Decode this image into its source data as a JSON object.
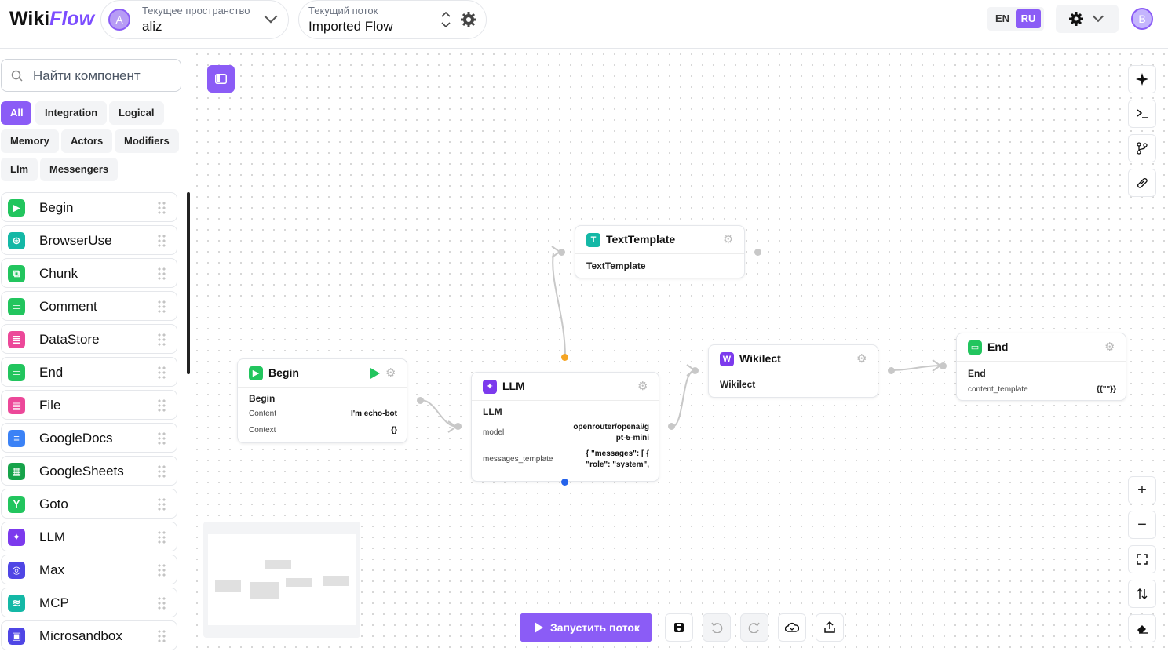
{
  "header": {
    "logo_wiki": "Wiki",
    "logo_flow": "Flow",
    "workspace": {
      "label": "Текущее пространство",
      "value": "aliz",
      "avatar": "A"
    },
    "flow": {
      "label": "Текущий поток",
      "value": "Imported Flow"
    },
    "lang_en": "EN",
    "lang_ru": "RU",
    "user_avatar": "B"
  },
  "sidebar": {
    "search_placeholder": "Найти компонент",
    "filters": [
      "All",
      "Integration",
      "Logical",
      "Memory",
      "Actors",
      "Modifiers",
      "Llm",
      "Messengers"
    ],
    "components": [
      {
        "label": "Begin",
        "icon": "play-icon",
        "color": "#22c55e",
        "glyph": "▶"
      },
      {
        "label": "BrowserUse",
        "icon": "globe-icon",
        "color": "#14b8a6",
        "glyph": "⊕"
      },
      {
        "label": "Chunk",
        "icon": "chunk-icon",
        "color": "#22c55e",
        "glyph": "⧉"
      },
      {
        "label": "Comment",
        "icon": "comment-icon",
        "color": "#22c55e",
        "glyph": "▭"
      },
      {
        "label": "DataStore",
        "icon": "database-icon",
        "color": "#ec4899",
        "glyph": "≣"
      },
      {
        "label": "End",
        "icon": "end-icon",
        "color": "#22c55e",
        "glyph": "▭"
      },
      {
        "label": "File",
        "icon": "file-icon",
        "color": "#ec4899",
        "glyph": "▤"
      },
      {
        "label": "GoogleDocs",
        "icon": "google-docs-icon",
        "color": "#3b82f6",
        "glyph": "≡"
      },
      {
        "label": "GoogleSheets",
        "icon": "google-sheets-icon",
        "color": "#16a34a",
        "glyph": "▦"
      },
      {
        "label": "Goto",
        "icon": "branch-icon",
        "color": "#22c55e",
        "glyph": "Y"
      },
      {
        "label": "LLM",
        "icon": "sparkle-icon",
        "color": "#7c3aed",
        "glyph": "✦"
      },
      {
        "label": "Max",
        "icon": "max-icon",
        "color": "#4f46e5",
        "glyph": "◎"
      },
      {
        "label": "MCP",
        "icon": "mcp-icon",
        "color": "#14b8a6",
        "glyph": "≋"
      },
      {
        "label": "Microsandbox",
        "icon": "sandbox-icon",
        "color": "#4f46e5",
        "glyph": "▣"
      }
    ]
  },
  "nodes": {
    "textTemplate": {
      "title": "TextTemplate",
      "sub": "TextTemplate",
      "glyph": "T"
    },
    "begin": {
      "title": "Begin",
      "sub": "Begin",
      "glyph": "▶",
      "fields": [
        {
          "k": "Content",
          "v": "I'm echo-bot"
        },
        {
          "k": "Context",
          "v": "{}"
        }
      ]
    },
    "llm": {
      "title": "LLM",
      "sub": "LLM",
      "glyph": "✦",
      "fields": [
        {
          "k": "model",
          "v1": "openrouter/openai/g",
          "v2": "pt-5-mini"
        },
        {
          "k": "messages_template",
          "v1": "{ \"messages\": [ {",
          "v2": "\"role\": \"system\","
        }
      ]
    },
    "wikilect": {
      "title": "Wikilect",
      "sub": "Wikilect",
      "glyph": "W"
    },
    "end": {
      "title": "End",
      "sub": "End",
      "glyph": "▭",
      "fields": [
        {
          "k": "content_template",
          "v": "{{\"\"}}"
        }
      ]
    }
  },
  "toolbar_right": [
    "sparkle-icon",
    "terminal-icon",
    "git-branch-icon",
    "link-icon"
  ],
  "toolbar_zoom": [
    "zoom-in-icon",
    "zoom-out-icon",
    "fit-view-icon",
    "sort-icon",
    "eraser-icon"
  ],
  "bottom": {
    "run_label": "Запустить поток"
  },
  "colors": {
    "accent": "#8b5cf6",
    "handle_orange": "#f5a524",
    "handle_blue": "#2563eb"
  }
}
